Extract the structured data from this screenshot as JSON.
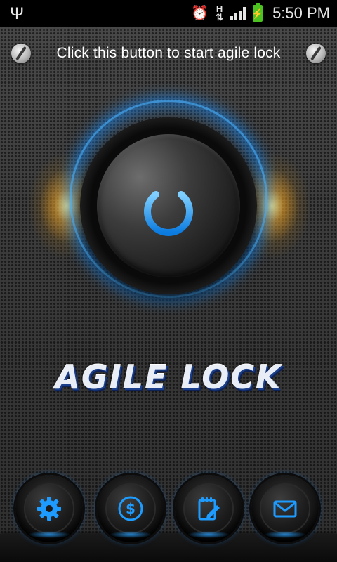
{
  "status_bar": {
    "time": "5:50 PM",
    "network_type": "H",
    "icons": [
      "usb-icon",
      "alarm-icon",
      "data-arrows-icon",
      "signal-icon",
      "battery-charging-icon"
    ]
  },
  "header": {
    "hint": "Click this button to start agile lock",
    "left_decoration": "screw-icon",
    "right_decoration": "screw-icon"
  },
  "power_button": {
    "icon": "power-icon",
    "accent": "#1e9bff"
  },
  "title": "AGILE LOCK",
  "dock": [
    {
      "icon": "settings-gear-icon"
    },
    {
      "icon": "dollar-coin-icon"
    },
    {
      "icon": "notepad-edit-icon"
    },
    {
      "icon": "mail-envelope-icon"
    }
  ],
  "colors": {
    "accent_blue": "#1e9bff",
    "glow_gold": "#ffc850",
    "status_bar_bg": "#000000",
    "battery_green": "#4cc221"
  }
}
